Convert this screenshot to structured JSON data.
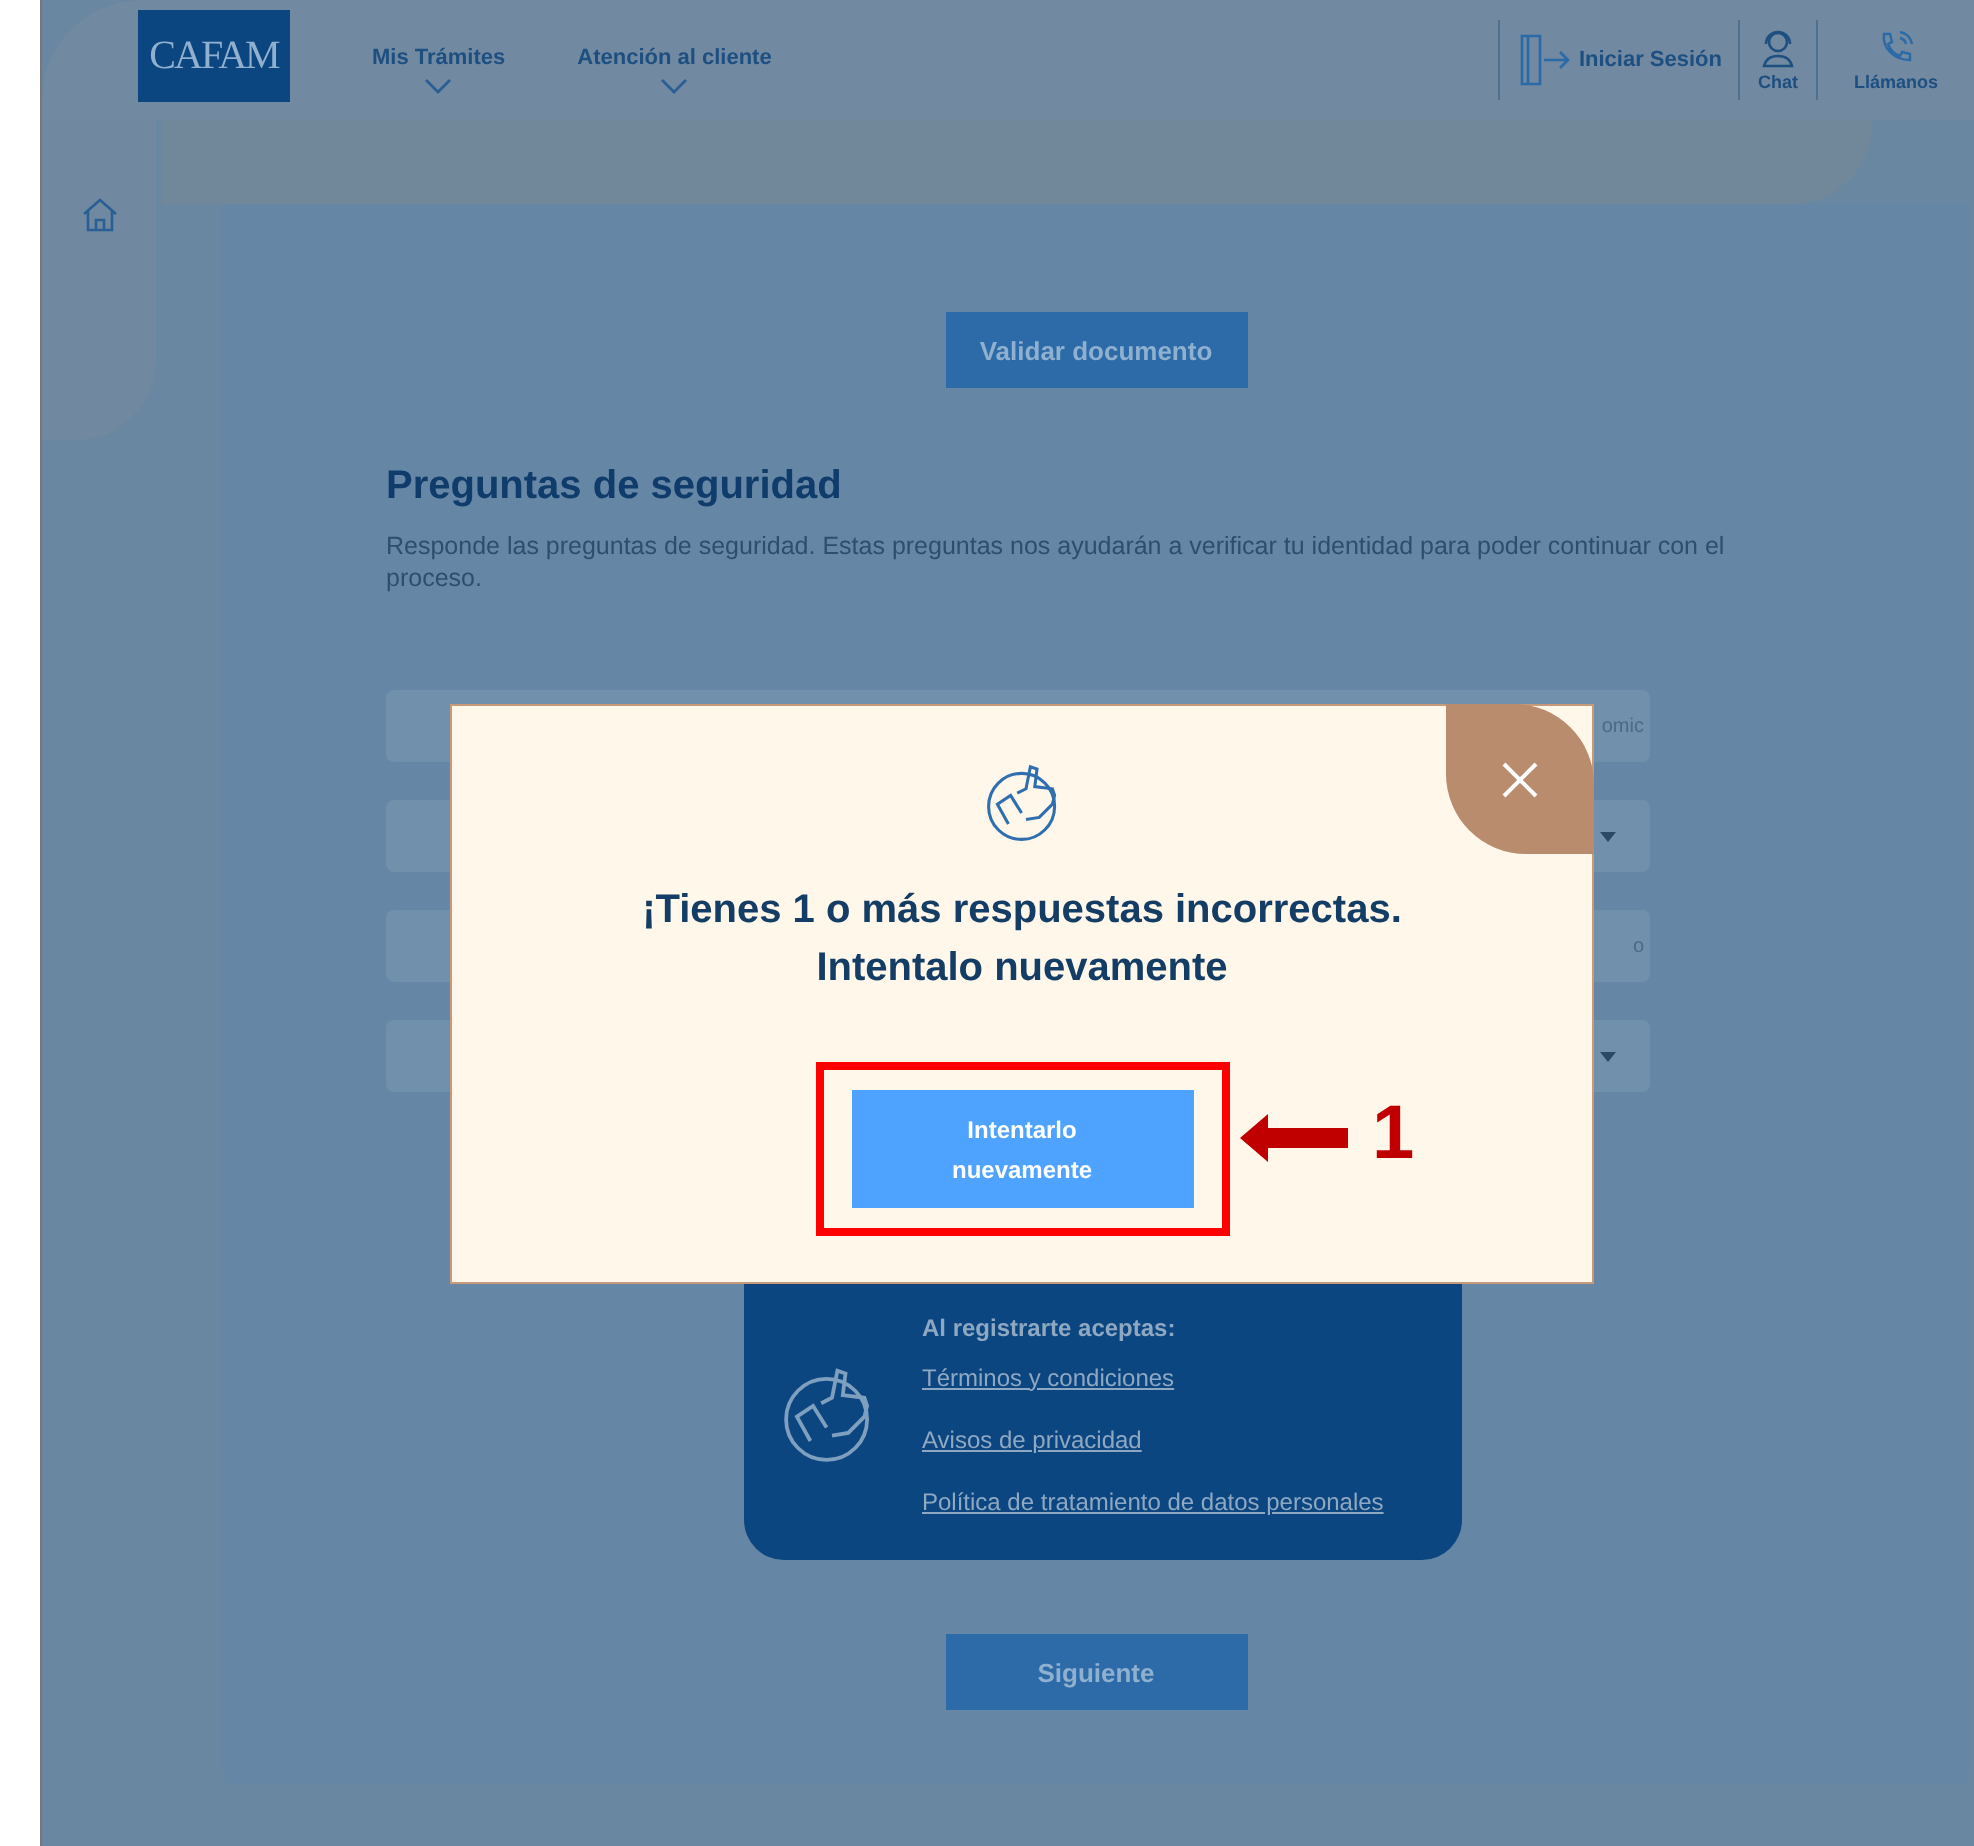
{
  "header": {
    "logo": "CAFAM",
    "nav": [
      {
        "label": "Mis Trámites"
      },
      {
        "label": "Atención al cliente"
      }
    ],
    "actions": [
      {
        "kind": "login",
        "label": "Iniciar Sesión"
      },
      {
        "kind": "chat",
        "label": "Chat"
      },
      {
        "kind": "phone",
        "label": "Llámanos"
      }
    ]
  },
  "page": {
    "validate_button": "Validar documento",
    "title": "Preguntas de seguridad",
    "description": "Responde las preguntas de seguridad. Estas preguntas nos ayudarán a verificar tu identidad para poder continuar con el proceso.",
    "fields": [
      {
        "kind": "text",
        "value": "omic"
      },
      {
        "kind": "select"
      },
      {
        "kind": "text",
        "value": "o"
      },
      {
        "kind": "select"
      }
    ],
    "terms": {
      "heading": "Al registrarte aceptas:",
      "links": [
        "Términos y condiciones",
        "Avisos de privacidad",
        "Política de tratamiento de datos personales"
      ]
    },
    "next_button": "Siguiente"
  },
  "modal": {
    "message": "¡Tienes 1 o más respuestas incorrectas. Intentalo nuevamente",
    "button": "Intentarlo nuevamente"
  },
  "annotation": {
    "number": "1"
  }
}
